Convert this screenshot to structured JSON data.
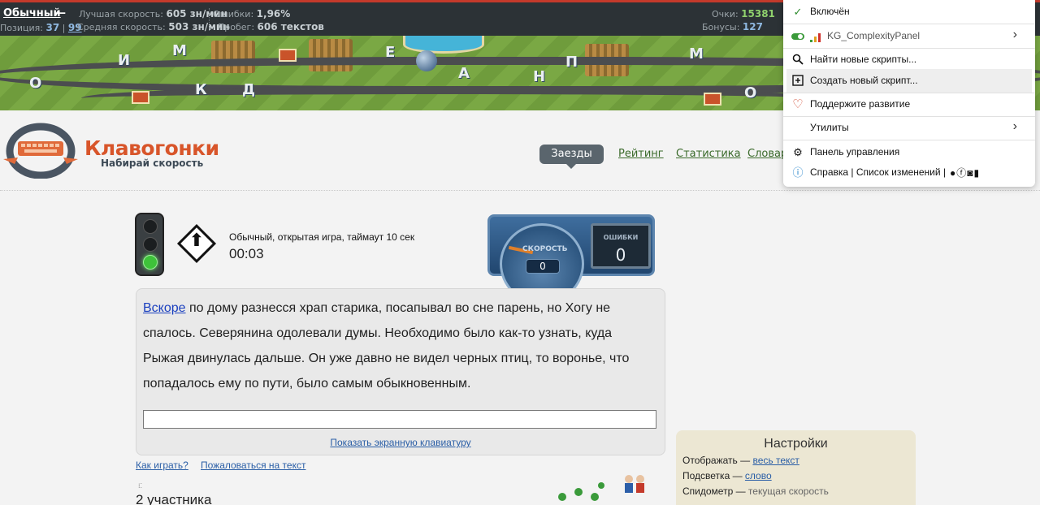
{
  "topbar": {
    "mode": "Обычный",
    "dash": "—",
    "position_label": "Позиция:",
    "position_value": "37",
    "position_sep": "|",
    "position_total": "99",
    "best_speed_label": "Лучшая скорость:",
    "best_speed_value": "605 зн/мин",
    "avg_speed_label": "Средняя скорость:",
    "avg_speed_value": "503 зн/мин",
    "errors_label": "Ошибки:",
    "errors_value": "1,96%",
    "mileage_label": "Пробег:",
    "mileage_value": "606 текстов",
    "points_label": "Очки:",
    "points_value": "15381",
    "bonus_label": "Бонусы:",
    "bonus_value": "127"
  },
  "banner": {
    "letters": [
      "И",
      "М",
      "К",
      "Д",
      "О",
      "Е",
      "А",
      "Н",
      "П",
      "М",
      "О"
    ]
  },
  "logo": {
    "name": "Клавогонки",
    "tagline": "Набирай скорость"
  },
  "nav": {
    "items": [
      "Заезды",
      "Рейтинг",
      "Статистика",
      "Словари"
    ]
  },
  "race": {
    "description": "Обычный, открытая игра, таймаут 10 сек",
    "timer": "00:03",
    "speed_label": "СКОРОСТЬ",
    "speed_value": "0",
    "errors_label": "ОШИБКИ",
    "errors_value": "0"
  },
  "typing": {
    "current_word": "Вскоре",
    "rest_text": " по дому разнесся храп старика, посапывал во сне парень, но Хогу не спалось. Северянина одолевали думы. Необходимо было как-то узнать, куда Рыжая двинулась дальше. Он уже давно не видел черных птиц, то воронье, что попадалось ему по пути, было самым обыкновенным.",
    "input_value": "",
    "keyboard_link": "Показать экранную клавиатуру"
  },
  "links": {
    "how_to_play": "Как играть?",
    "report_text": "Пожаловаться на текст"
  },
  "participants": "2 участника",
  "settings": {
    "title": "Настройки",
    "rows": [
      {
        "label": "Отображать —",
        "value": "весь текст"
      },
      {
        "label": "Подсветка —",
        "value": "слово"
      },
      {
        "label": "Спидометр —",
        "value": "текущая скорость"
      }
    ]
  },
  "menu": {
    "enabled": "Включён",
    "script_name": "KG_ComplexityPanel",
    "find_scripts": "Найти новые скрипты...",
    "create_script": "Создать новый скрипт...",
    "support": "Поддержите развитие",
    "utilities": "Утилиты",
    "dashboard": "Панель управления",
    "help": "Справка | Список изменений |",
    "colors": {
      "check": "#2e8b2e",
      "toggle": "#3a9a3a",
      "heart": "#d0462e",
      "info": "#1f7fc8"
    }
  }
}
